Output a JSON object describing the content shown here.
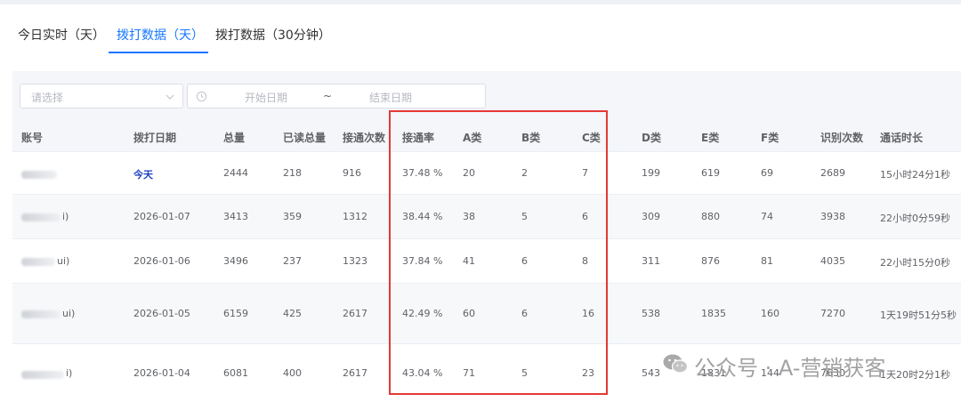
{
  "tabs": [
    {
      "label": "今日实时（天）",
      "active": false
    },
    {
      "label": "拨打数据（天）",
      "active": true
    },
    {
      "label": "拨打数据（30分钟）",
      "active": false
    }
  ],
  "filters": {
    "select_placeholder": "请选择",
    "start_placeholder": "开始日期",
    "separator": "~",
    "end_placeholder": "结束日期"
  },
  "table": {
    "headers": [
      "账号",
      "拨打日期",
      "总量",
      "已读总量",
      "接通次数",
      "接通率",
      "A类",
      "B类",
      "C类",
      "D类",
      "E类",
      "F类",
      "识别次数",
      "通话时长"
    ],
    "rows": [
      {
        "account": "",
        "date": "今天",
        "total": "2444",
        "read": "218",
        "connected": "916",
        "rate": "37.48 %",
        "a": "20",
        "b": "2",
        "c": "7",
        "d": "199",
        "e": "619",
        "f": "69",
        "recog": "2689",
        "duration": "15小时24分1秒"
      },
      {
        "account": "i)",
        "date": "2026-01-07",
        "total": "3413",
        "read": "359",
        "connected": "1312",
        "rate": "38.44 %",
        "a": "38",
        "b": "5",
        "c": "6",
        "d": "309",
        "e": "880",
        "f": "74",
        "recog": "3938",
        "duration": "22小时0分59秒"
      },
      {
        "account": "ui)",
        "date": "2026-01-06",
        "total": "3496",
        "read": "237",
        "connected": "1323",
        "rate": "37.84 %",
        "a": "41",
        "b": "6",
        "c": "8",
        "d": "311",
        "e": "876",
        "f": "81",
        "recog": "4035",
        "duration": "22小时15分0秒"
      },
      {
        "account": "ui)",
        "date": "2026-01-05",
        "total": "6159",
        "read": "425",
        "connected": "2617",
        "rate": "42.49 %",
        "a": "60",
        "b": "6",
        "c": "16",
        "d": "538",
        "e": "1835",
        "f": "160",
        "recog": "7270",
        "duration": "1天19时51分5秒"
      },
      {
        "account": "i)",
        "date": "2026-01-04",
        "total": "6081",
        "read": "400",
        "connected": "2617",
        "rate": "43.04 %",
        "a": "71",
        "b": "5",
        "c": "23",
        "d": "543",
        "e": "1831",
        "f": "144",
        "recog": "7630",
        "duration": "1天20时2分1秒"
      }
    ]
  },
  "watermark": {
    "text": "公众号 · A-营销获客",
    "icon": "wechat-icon"
  }
}
